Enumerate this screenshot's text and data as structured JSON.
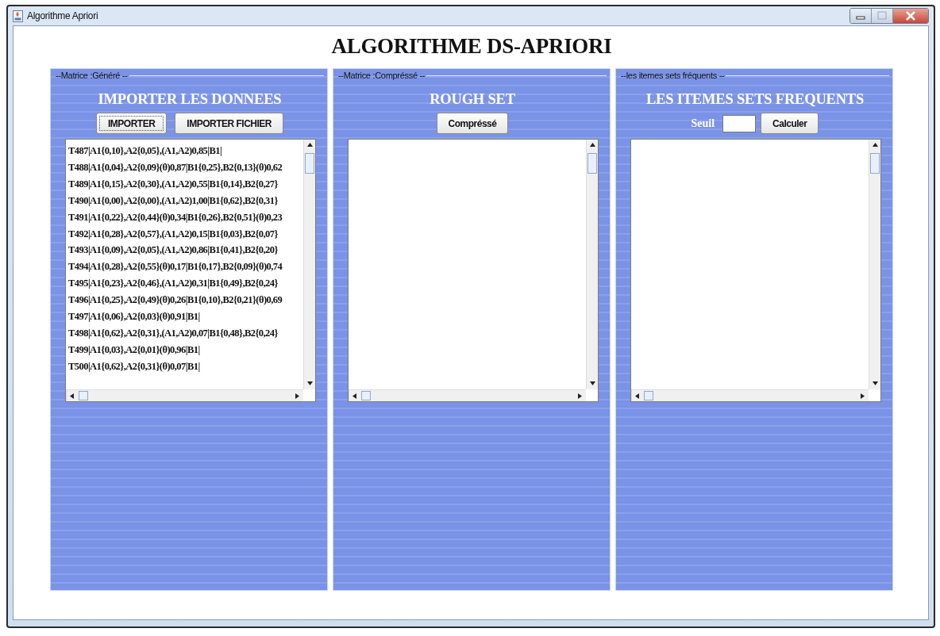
{
  "window": {
    "title": "Algorithme Apriori"
  },
  "heading": "ALGORITHME DS-APRIORI",
  "panels": [
    {
      "legend": "--Matrice :Généré --",
      "title": "IMPORTER LES DONNEES",
      "kind": "buttons",
      "buttons": [
        {
          "label": "IMPORTER",
          "focused": true
        },
        {
          "label": "IMPORTER FICHIER",
          "focused": false
        }
      ],
      "lines": [
        "T487|A1{0,10},A2{0,05},(A1,A2)0,85|B1|",
        "T488|A1{0,04},A2{0,09}(θ)0,87|B1{0,25},B2{0,13}(θ)0,62",
        "T489|A1{0,15},A2{0,30},(A1,A2)0,55|B1{0,14},B2{0,27}",
        "T490|A1{0,00},A2{0,00},(A1,A2)1,00|B1{0,62},B2{0,31}",
        "T491|A1{0,22},A2{0,44}(θ)0,34|B1{0,26},B2{0,51}(θ)0,23",
        "T492|A1{0,28},A2{0,57},(A1,A2)0,15|B1{0,03},B2{0,07}",
        "T493|A1{0,09},A2{0,05},(A1,A2)0,86|B1{0,41},B2{0,20}",
        "T494|A1{0,28},A2{0,55}(θ)0,17|B1{0,17},B2{0,09}(θ)0,74",
        "T495|A1{0,23},A2{0,46},(A1,A2)0,31|B1{0,49},B2{0,24}",
        "T496|A1{0,25},A2{0,49}(θ)0,26|B1{0,10},B2{0,21}(θ)0,69",
        "T497|A1{0,06},A2{0,03}(θ)0,91|B1|",
        "T498|A1{0,62},A2{0,31},(A1,A2)0,07|B1{0,48},B2{0,24}",
        "T499|A1{0,03},A2{0,01}(θ)0,96|B1|",
        "T500|A1{0,62},A2{0,31}(θ)0,07|B1|"
      ]
    },
    {
      "legend": "--Matrice :Compréssé --",
      "title": "ROUGH SET",
      "kind": "buttons",
      "buttons": [
        {
          "label": "Compréssé",
          "focused": false
        }
      ]
    },
    {
      "legend": "--les itemes sets fréquents --",
      "title": "LES ITEMES SETS FREQUENTS",
      "kind": "threshold",
      "field_label": "Seuil",
      "buttons": [
        {
          "label": "Calculer",
          "focused": false
        }
      ]
    }
  ]
}
